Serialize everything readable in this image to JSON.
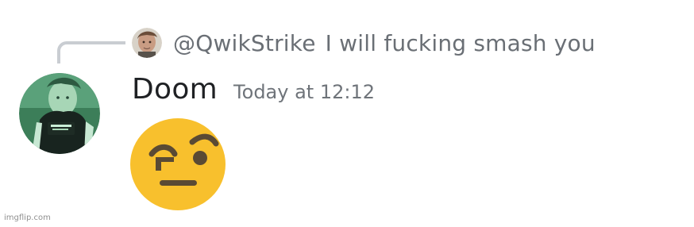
{
  "reply": {
    "author": "@QwikStrike",
    "content": "I will fucking smash you"
  },
  "message": {
    "username": "Doom",
    "timestamp": "Today at 12:12",
    "emoji": "face-with-raised-eyebrow-emoji"
  },
  "watermark": "imgflip.com",
  "colors": {
    "background": "#ffffff",
    "reply_text": "#6a6f75",
    "username": "#1f2124",
    "timestamp": "#6f747a",
    "spine": "#c9cdd2",
    "emoji_face": "#f8c02d",
    "emoji_features": "#5a4a34"
  }
}
